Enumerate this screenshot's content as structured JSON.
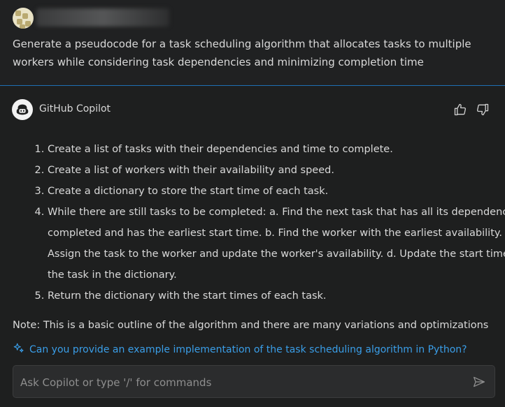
{
  "user": {
    "avatar_icon": "user-avatar",
    "prompt": "Generate a pseudocode for a task scheduling algorithm that allocates tasks to multiple workers while considering task dependencies and minimizing completion time"
  },
  "assistant": {
    "name": "GitHub Copilot",
    "avatar_icon": "copilot-icon",
    "thumbs_up_icon": "thumbs-up-icon",
    "thumbs_down_icon": "thumbs-down-icon",
    "steps": [
      "Create a list of tasks with their dependencies and time to complete.",
      "Create a list of workers with their availability and speed.",
      "Create a dictionary to store the start time of each task.",
      "While there are still tasks to be completed: a. Find the next task that has all its dependencies completed and has the earliest start time. b. Find the worker with the earliest availability. c. Assign the task to the worker and update the worker's availability. d. Update the start time of the task in the dictionary.",
      "Return the dictionary with the start times of each task."
    ],
    "note": "Note: This is a basic outline of the algorithm and there are many variations and optimizations"
  },
  "suggestion": {
    "icon": "sparkle-icon",
    "text": "Can you provide an example implementation of the task scheduling algorithm in Python?"
  },
  "input": {
    "placeholder": "Ask Copilot or type '/' for commands",
    "value": "",
    "send_icon": "send-icon"
  },
  "colors": {
    "background": "#1e1f1f",
    "divider": "#1f6fb4",
    "link": "#3a9ee8",
    "text": "#d9d9d9"
  }
}
